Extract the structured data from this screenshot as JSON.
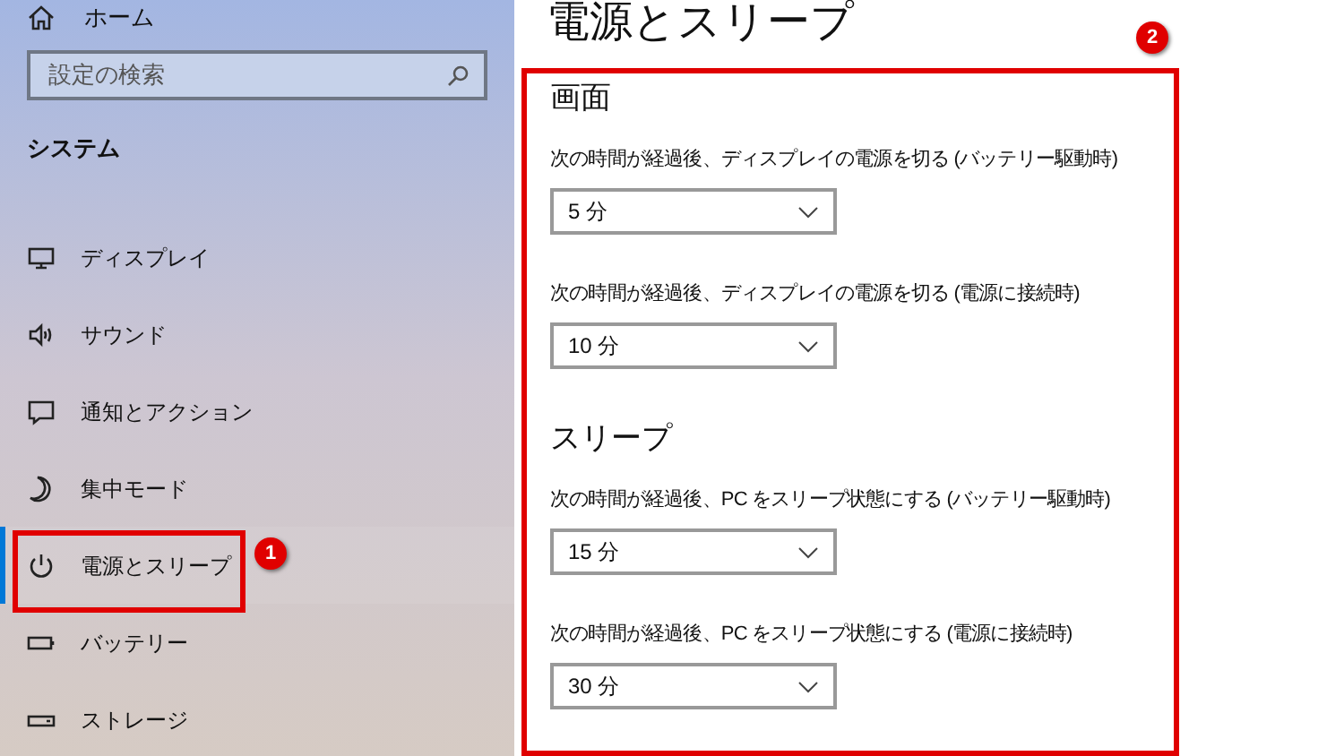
{
  "sidebar": {
    "home": "ホーム",
    "search": {
      "placeholder": "設定の検索"
    },
    "section_title": "システム",
    "items": [
      {
        "kind": "display",
        "label": "ディスプレイ",
        "selected": false
      },
      {
        "kind": "sound",
        "label": "サウンド",
        "selected": false
      },
      {
        "kind": "notifications",
        "label": "通知とアクション",
        "selected": false
      },
      {
        "kind": "focus",
        "label": "集中モード",
        "selected": false
      },
      {
        "kind": "power",
        "label": "電源とスリープ",
        "selected": true,
        "callout": "1"
      },
      {
        "kind": "battery",
        "label": "バッテリー",
        "selected": false
      },
      {
        "kind": "storage",
        "label": "ストレージ",
        "selected": false
      }
    ]
  },
  "page": {
    "title": "電源とスリープ",
    "callout": "2",
    "sections": [
      {
        "heading": "画面",
        "settings": [
          {
            "label": "次の時間が経過後、ディスプレイの電源を切る (バッテリー駆動時)",
            "value": "5 分"
          },
          {
            "label": "次の時間が経過後、ディスプレイの電源を切る (電源に接続時)",
            "value": "10 分"
          }
        ]
      },
      {
        "heading": "スリープ",
        "settings": [
          {
            "label": "次の時間が経過後、PC をスリープ状態にする (バッテリー駆動時)",
            "value": "15 分"
          },
          {
            "label": "次の時間が経過後、PC をスリープ状態にする (電源に接続時)",
            "value": "30 分"
          }
        ]
      }
    ]
  }
}
